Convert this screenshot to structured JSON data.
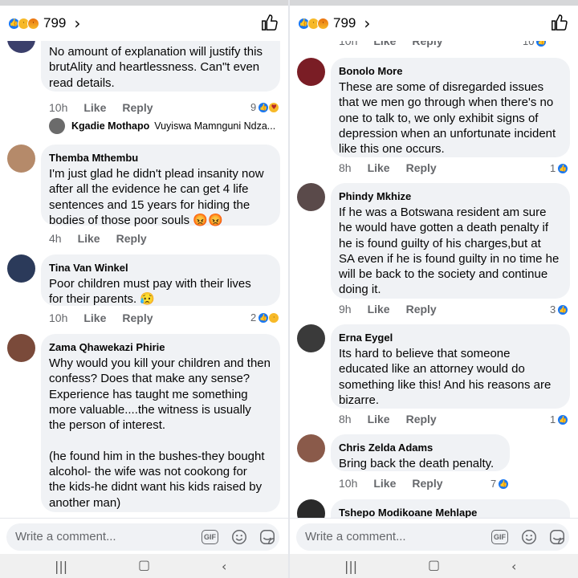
{
  "panes": [
    {
      "header": {
        "reaction_count": "799",
        "reactions": [
          "like-icon",
          "sad-icon",
          "angry-icon"
        ]
      },
      "comments": [
        {
          "name": "",
          "text": "No amount of explanation will justify this\nbrutAlity and heartlessness. Can\"t even\nread details.",
          "time": "10h",
          "like": "Like",
          "reply": "Reply",
          "reaction_count": "9",
          "reactions": [
            "like-icon",
            "care-icon"
          ]
        },
        {
          "name": "Themba Mthembu",
          "text": "I'm just glad he didn't plead insanity now\nafter all the evidence he can get 4 life\nsentences and 15 years for hiding the\nbodies of those poor souls 😡😡",
          "time": "4h",
          "like": "Like",
          "reply": "Reply",
          "reaction_count": "",
          "reactions": []
        },
        {
          "name": "Tina Van Winkel",
          "text": "Poor children must pay with their lives\nfor their parents. 😥",
          "time": "10h",
          "like": "Like",
          "reply": "Reply",
          "reaction_count": "2",
          "reactions": [
            "like-icon",
            "sad-icon"
          ]
        },
        {
          "name": "Zama Qhawekazi Phirie",
          "text": "Why would you kill your children and then\nconfess? Does that make any sense?\nExperience has taught me something\nmore valuable....the witness is usually\nthe person of interest.\n\n(he found him in the bushes-they bought\nalcohol- the wife was not cookong for\nthe kids-he didnt want his kids raised by\nanother man)",
          "time": "",
          "like": "",
          "reply": "",
          "reaction_count": "",
          "reactions": []
        }
      ],
      "reply_preview": {
        "name": "Kgadie Mothapo",
        "text": "Vuyiswa Mamnguni Ndza..."
      },
      "composer": {
        "placeholder": "Write a comment..."
      }
    },
    {
      "header": {
        "reaction_count": "799",
        "reactions": [
          "like-icon",
          "sad-icon",
          "angry-icon"
        ]
      },
      "comments": [
        {
          "name": "Bonolo More",
          "text": "These are some of disregarded issues\nthat we men go through when there's no\none to talk to, we only exhibit signs of\ndepression when an unfortunate incident\nlike this one occurs.",
          "time": "8h",
          "like": "Like",
          "reply": "Reply",
          "reaction_count": "1",
          "reactions": [
            "like-icon"
          ]
        },
        {
          "name": "Phindy Mkhize",
          "text": "If he was a Botswana resident am sure\nhe would have gotten a death penalty if\nhe is found guilty of his charges,but at\nSA even if he is found guilty in no time he\nwill be back to the society and continue\ndoing it.",
          "time": "9h",
          "like": "Like",
          "reply": "Reply",
          "reaction_count": "3",
          "reactions": [
            "like-icon"
          ]
        },
        {
          "name": "Erna Eygel",
          "text": "Its hard to believe that someone\neducated like an attorney would do\nsomething like this!  And his reasons are\nbizarre.",
          "time": "8h",
          "like": "Like",
          "reply": "Reply",
          "reaction_count": "1",
          "reactions": [
            "like-icon"
          ]
        },
        {
          "name": "Chris Zelda Adams",
          "text": "Bring back the death penalty.",
          "time": "10h",
          "like": "Like",
          "reply": "Reply",
          "reaction_count": "7",
          "reactions": [
            "like-icon"
          ]
        },
        {
          "name": "Tshepo Modikoane Mehlape",
          "text": "",
          "time": "",
          "like": "",
          "reply": "",
          "reaction_count": "",
          "reactions": []
        }
      ],
      "top_cutoff": {
        "time": "10h",
        "like": "Like",
        "reply": "Reply",
        "reaction_count": "10"
      },
      "composer": {
        "placeholder": "Write a comment..."
      }
    }
  ],
  "composer_icons": [
    "gif-icon",
    "emoji-icon",
    "sticker-icon"
  ],
  "gif_label": "GIF",
  "nav_icons": [
    "recent-apps-icon",
    "home-icon",
    "back-icon"
  ],
  "colors": {
    "accent": "#1877f2",
    "bubble": "#f0f2f5",
    "muted": "#65676b"
  }
}
